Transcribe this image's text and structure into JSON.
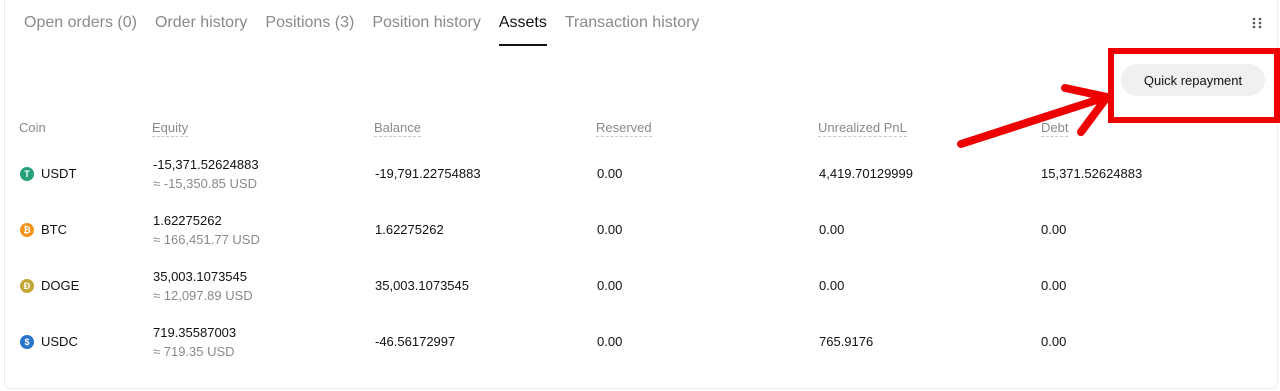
{
  "tabs": [
    {
      "label": "Open orders (0)"
    },
    {
      "label": "Order history"
    },
    {
      "label": "Positions (3)"
    },
    {
      "label": "Position history"
    },
    {
      "label": "Assets"
    },
    {
      "label": "Transaction history"
    }
  ],
  "active_tab": "Assets",
  "actions": {
    "quick_repayment": "Quick repayment"
  },
  "table": {
    "headers": {
      "coin": "Coin",
      "equity": "Equity",
      "balance": "Balance",
      "reserved": "Reserved",
      "unrealized_pnl": "Unrealized PnL",
      "debt": "Debt"
    },
    "rows": [
      {
        "coin": "USDT",
        "icon": "tether-icon",
        "icon_glyph": "T",
        "icon_color": "#26a17b",
        "equity": "-15,371.52624883",
        "equity_usd": "≈ -15,350.85 USD",
        "balance": "-19,791.22754883",
        "reserved": "0.00",
        "unrealized_pnl": "4,419.70129999",
        "debt": "15,371.52624883"
      },
      {
        "coin": "BTC",
        "icon": "bitcoin-icon",
        "icon_glyph": "₿",
        "icon_color": "#f7931a",
        "equity": "1.62275262",
        "equity_usd": "≈ 166,451.77 USD",
        "balance": "1.62275262",
        "reserved": "0.00",
        "unrealized_pnl": "0.00",
        "debt": "0.00"
      },
      {
        "coin": "DOGE",
        "icon": "dogecoin-icon",
        "icon_glyph": "Ð",
        "icon_color": "#c2a633",
        "equity": "35,003.1073545",
        "equity_usd": "≈ 12,097.89 USD",
        "balance": "35,003.1073545",
        "reserved": "0.00",
        "unrealized_pnl": "0.00",
        "debt": "0.00"
      },
      {
        "coin": "USDC",
        "icon": "usdc-icon",
        "icon_glyph": "$",
        "icon_color": "#2775ca",
        "equity": "719.35587003",
        "equity_usd": "≈ 719.35 USD",
        "balance": "-46.56172997",
        "reserved": "0.00",
        "unrealized_pnl": "765.9176",
        "debt": "0.00"
      }
    ]
  },
  "colors": {
    "highlight": "#ee0000",
    "text": "#121212",
    "muted": "#8a8a8a"
  }
}
